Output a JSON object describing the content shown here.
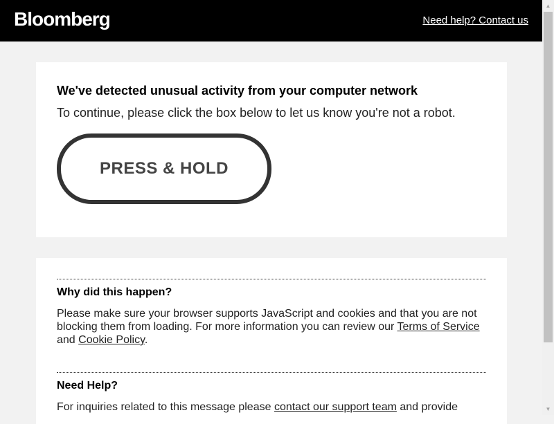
{
  "header": {
    "logo": "Bloomberg",
    "help_link": "Need help? Contact us"
  },
  "captcha": {
    "title": "We've detected unusual activity from your computer network",
    "subtitle": "To continue, please click the box below to let us know you're not a robot.",
    "button_label": "PRESS & HOLD"
  },
  "info": {
    "why_title": "Why did this happen?",
    "why_text_1": "Please make sure your browser supports JavaScript and cookies and that you are not blocking them from loading. For more information you can review our ",
    "terms_link": "Terms of Service",
    "why_text_2": " and ",
    "cookie_link": "Cookie Policy",
    "why_text_3": ".",
    "help_title": "Need Help?",
    "help_text_1": "For inquiries related to this message please ",
    "support_link": "contact our support team",
    "help_text_2": " and provide"
  },
  "scrollbar": {
    "up_icon": "triangle-up",
    "down_icon": "triangle-down"
  }
}
